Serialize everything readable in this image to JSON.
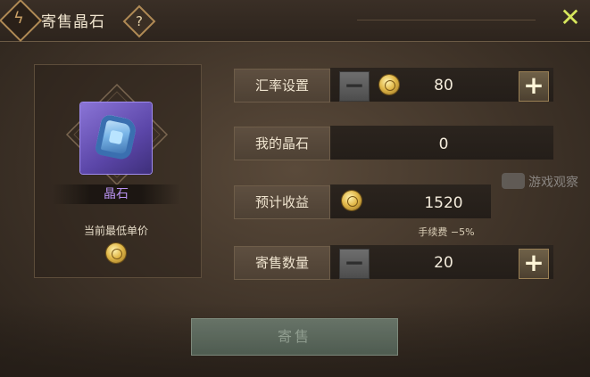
{
  "header": {
    "title": "寄售晶石",
    "help_symbol": "?",
    "close_symbol": "✕"
  },
  "item": {
    "name": "晶石",
    "lowest_price_label": "当前最低单价"
  },
  "rows": {
    "exchange_rate": {
      "label": "汇率设置",
      "value": "80"
    },
    "my_crystals": {
      "label": "我的晶石",
      "value": "0"
    },
    "expected_income": {
      "label": "预计收益",
      "value": "1520"
    },
    "sell_quantity": {
      "label": "寄售数量",
      "value": "20"
    }
  },
  "fee_note": "手续费 −5%",
  "controls": {
    "minus": "−",
    "plus": "+"
  },
  "watermark": {
    "text": "游戏观察"
  },
  "footer": {
    "sell_label": "寄售"
  },
  "colors": {
    "item_name": "#b892f0",
    "close": "#d6e65c",
    "gold": "#e2b94a"
  }
}
